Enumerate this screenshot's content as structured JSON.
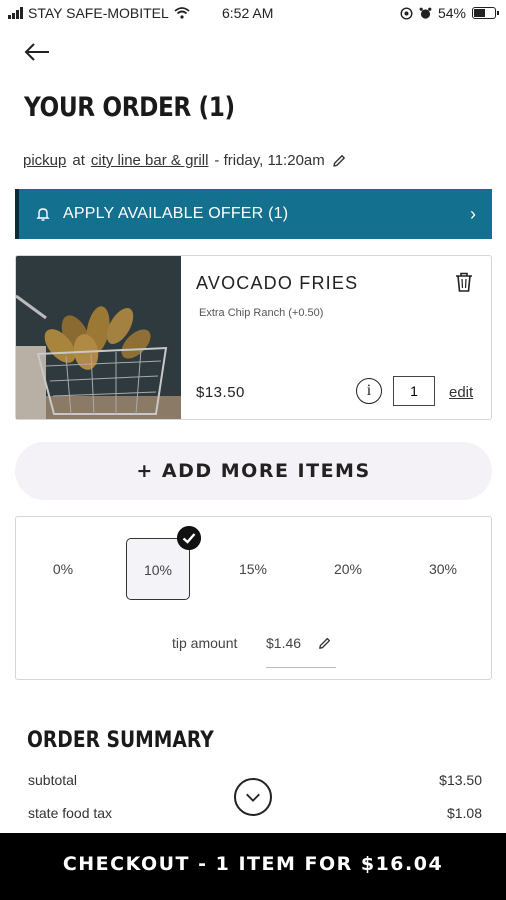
{
  "status_bar": {
    "carrier": "STAY SAFE-MOBITEL",
    "time": "6:52 AM",
    "battery": "54%"
  },
  "header": {
    "title": "YOUR ORDER (1)"
  },
  "pickup": {
    "mode": "pickup",
    "at": "at",
    "location": "city line bar & grill",
    "time": " - friday, 11:20am"
  },
  "offer": {
    "label": "APPLY AVAILABLE OFFER (1)"
  },
  "item": {
    "name": "AVOCADO FRIES",
    "modifier": "Extra Chip Ranch (+0.50)",
    "price": "$13.50",
    "quantity": "1",
    "edit_label": "edit"
  },
  "add_more": {
    "label": "+ ADD MORE ITEMS"
  },
  "tip": {
    "options": [
      "0%",
      "10%",
      "15%",
      "20%",
      "30%"
    ],
    "selected": "10%",
    "amount_label": "tip amount",
    "amount": "$1.46"
  },
  "summary": {
    "title": "ORDER SUMMARY",
    "rows": [
      {
        "label": "subtotal",
        "value": "$13.50"
      },
      {
        "label": "state food tax",
        "value": "$1.08"
      }
    ]
  },
  "checkout": {
    "label": "CHECKOUT - 1 ITEM FOR $16.04"
  },
  "colors": {
    "offer_banner": "#13708f",
    "checkout_bar": "#000000"
  }
}
